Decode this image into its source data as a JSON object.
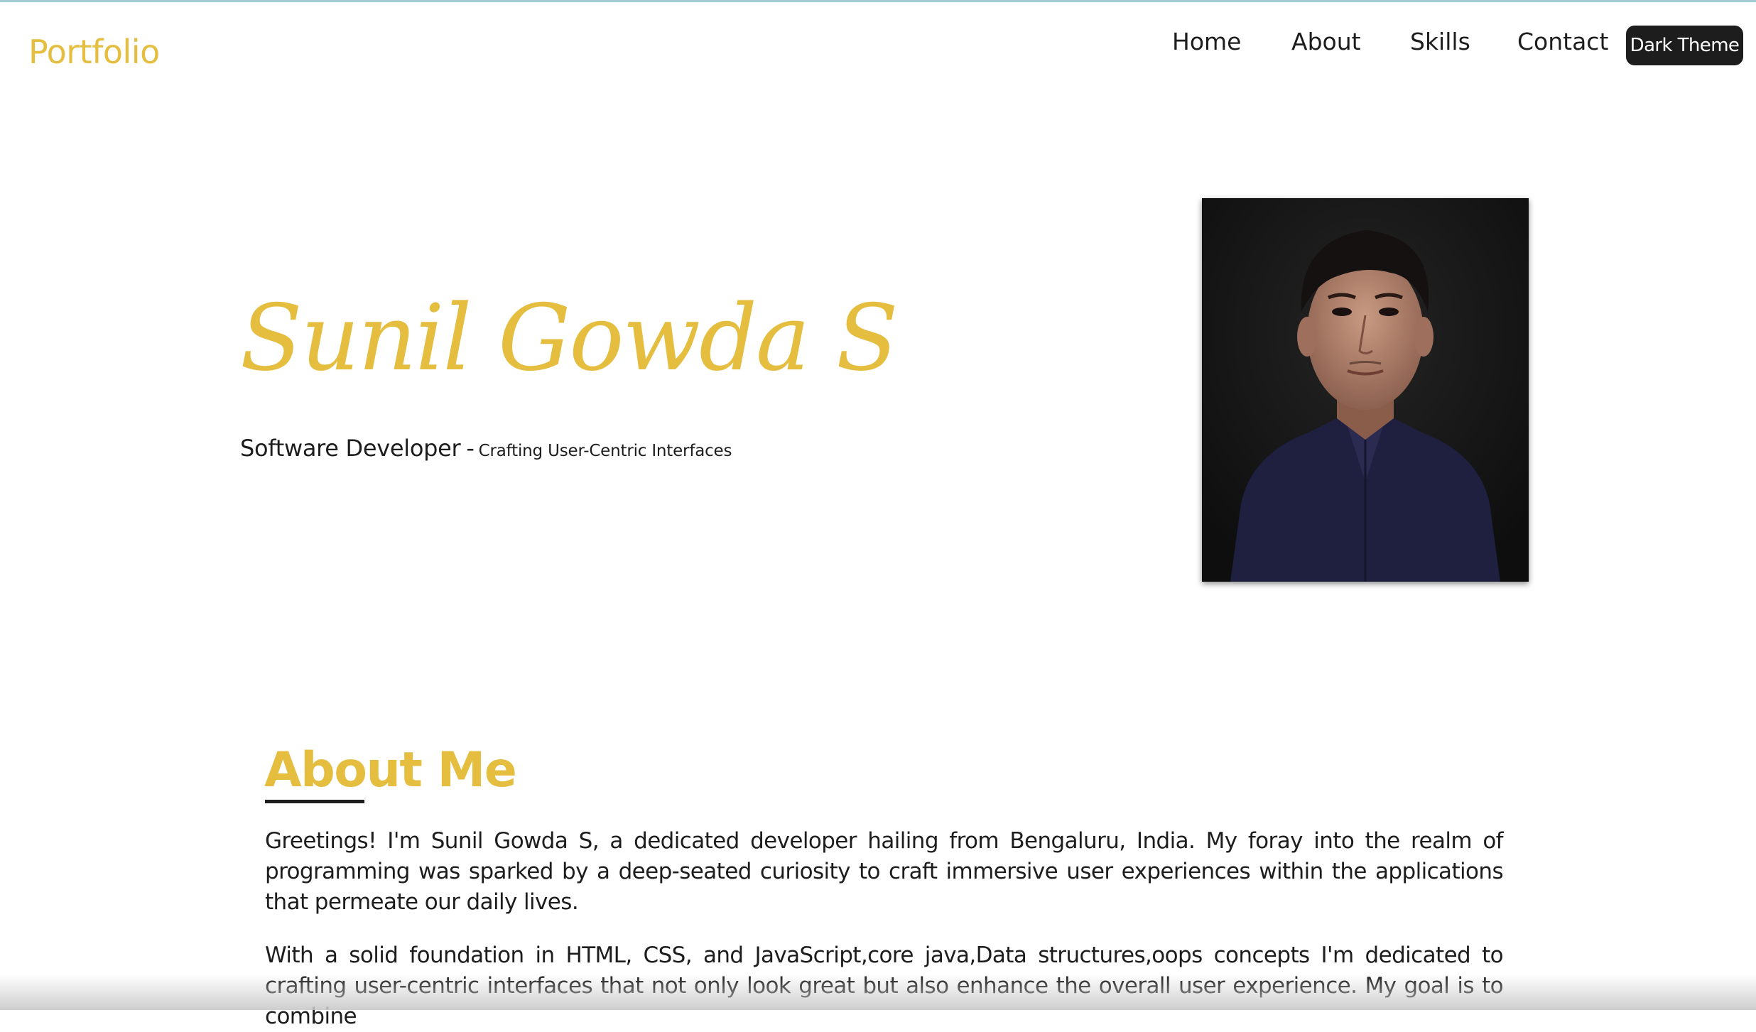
{
  "header": {
    "brand": "Portfolio",
    "nav": [
      {
        "label": "Home"
      },
      {
        "label": "About"
      },
      {
        "label": "Skills"
      },
      {
        "label": "Contact"
      }
    ],
    "theme_button_label": "Dark Theme"
  },
  "hero": {
    "name": "Sunil Gowda S",
    "role": "Software Developer",
    "separator": "-",
    "tagline": "Crafting User-Centric Interfaces"
  },
  "about": {
    "title": "About Me",
    "paragraphs": [
      "Greetings! I'm Sunil Gowda S, a dedicated developer hailing from Bengaluru, India. My foray into the realm of programming was sparked by a deep-seated curiosity to craft immersive user experiences within the applications that permeate our daily lives.",
      "With a solid foundation in HTML, CSS, and JavaScript,core java,Data structures,oops concepts I'm dedicated to crafting user-centric interfaces that not only look great but also enhance the overall user experience. My goal is to combine"
    ]
  },
  "colors": {
    "accent": "#e5bd3f",
    "text": "#1d1d1d",
    "top_border": "#9fcfd3"
  }
}
